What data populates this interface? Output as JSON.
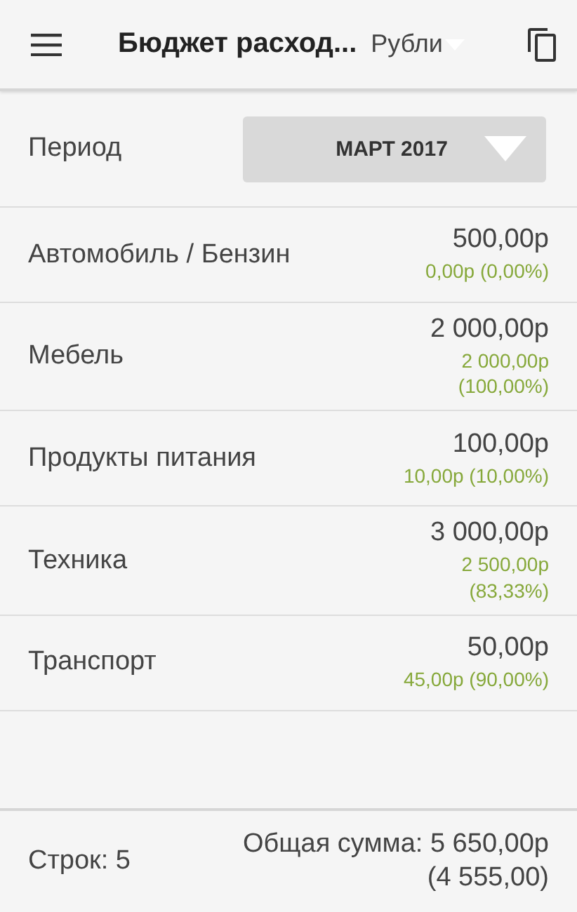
{
  "app_bar": {
    "title": "Бюджет расход...",
    "currency": "Рубли"
  },
  "period": {
    "label": "Период",
    "value": "МАРТ 2017"
  },
  "rows": [
    {
      "name": "Автомобиль / Бензин",
      "budget": "500,00р",
      "spent_lines": [
        "0,00р (0,00%)"
      ]
    },
    {
      "name": "Мебель",
      "budget": "2 000,00р",
      "spent_lines": [
        "2 000,00р",
        "(100,00%)"
      ]
    },
    {
      "name": "Продукты питания",
      "budget": "100,00р",
      "spent_lines": [
        "10,00р (10,00%)"
      ]
    },
    {
      "name": "Техника",
      "budget": "3 000,00р",
      "spent_lines": [
        "2 500,00р",
        "(83,33%)"
      ]
    },
    {
      "name": "Транспорт",
      "budget": "50,00р",
      "spent_lines": [
        "45,00р (90,00%)"
      ]
    }
  ],
  "footer": {
    "count": "Строк: 5",
    "total_lines": [
      "Общая сумма: 5 650,00р",
      "(4 555,00)"
    ]
  }
}
